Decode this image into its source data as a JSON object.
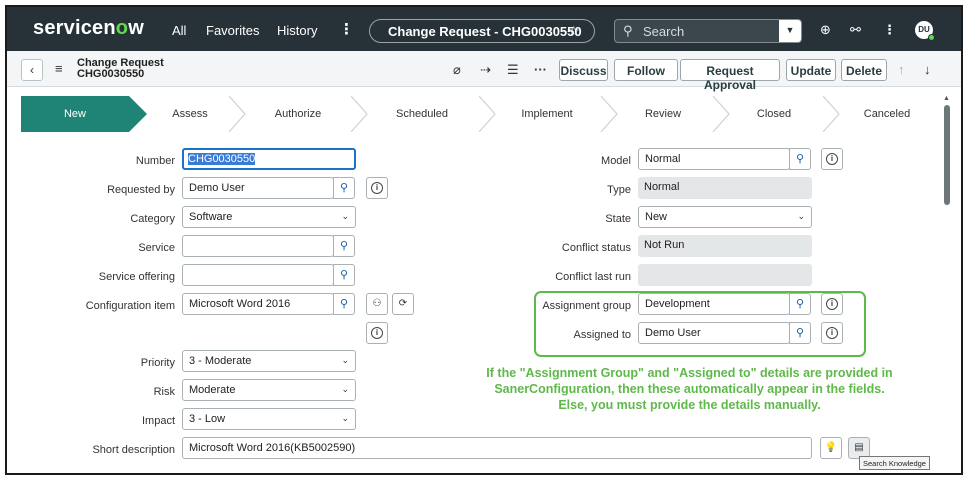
{
  "app": {
    "brand_prefix": "servicen",
    "brand_o": "o",
    "brand_suffix": "w",
    "nav": [
      "All",
      "Favorites",
      "History"
    ],
    "context_pill": "Change Request - CHG0030550",
    "search_placeholder": "Search",
    "user_initials": "DU"
  },
  "record": {
    "table_name": "Change Request",
    "number_title": "CHG0030550",
    "buttons": [
      "Discuss",
      "Follow",
      "Request Approval",
      "Update",
      "Delete"
    ]
  },
  "stages": [
    "New",
    "Assess",
    "Authorize",
    "Scheduled",
    "Implement",
    "Review",
    "Closed",
    "Canceled"
  ],
  "form_left": {
    "number": {
      "label": "Number",
      "value": "CHG0030550"
    },
    "requested_by": {
      "label": "Requested by",
      "value": "Demo User"
    },
    "category": {
      "label": "Category",
      "value": "Software"
    },
    "service": {
      "label": "Service",
      "value": ""
    },
    "service_offering": {
      "label": "Service offering",
      "value": ""
    },
    "configuration_item": {
      "label": "Configuration item",
      "value": "Microsoft Word 2016"
    },
    "priority": {
      "label": "Priority",
      "value": "3 - Moderate"
    },
    "risk": {
      "label": "Risk",
      "value": "Moderate"
    },
    "impact": {
      "label": "Impact",
      "value": "3 - Low"
    },
    "short_description": {
      "label": "Short description",
      "value": "Microsoft Word 2016(KB5002590)"
    }
  },
  "form_right": {
    "model": {
      "label": "Model",
      "value": "Normal"
    },
    "type": {
      "label": "Type",
      "value": "Normal"
    },
    "state": {
      "label": "State",
      "value": "New"
    },
    "conflict_status": {
      "label": "Conflict status",
      "value": "Not Run"
    },
    "conflict_last_run": {
      "label": "Conflict last run",
      "value": ""
    },
    "assignment_group": {
      "label": "Assignment group",
      "value": "Development"
    },
    "assigned_to": {
      "label": "Assigned to",
      "value": "Demo User"
    }
  },
  "annotation": {
    "line1": "If the \"Assignment Group\" and \"Assigned to\" details are provided in",
    "line2": "SanerConfiguration, then these automatically appear in the fields.",
    "line3": "Else, you must provide the details manually."
  },
  "tooltip": "Search Knowledge",
  "colors": {
    "topbar": "#263238",
    "active_stage": "#1f8476",
    "annotation": "#5fb94a",
    "focus": "#1b73c6"
  }
}
